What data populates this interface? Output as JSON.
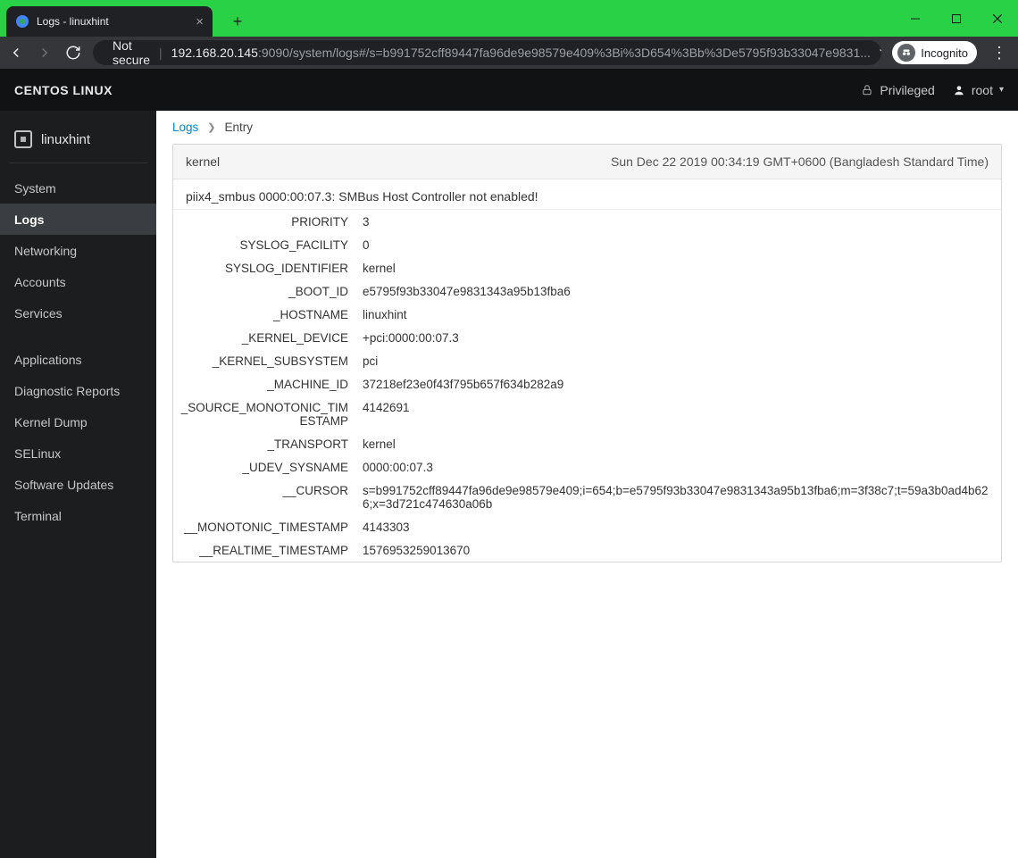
{
  "browser": {
    "tab_title": "Logs - linuxhint",
    "not_secure": "Not secure",
    "url_host": "192.168.20.145",
    "url_rest": ":9090/system/logs#/s=b991752cff89447fa96de9e98579e409%3Bi%3D654%3Bb%3De5795f93b33047e9831...",
    "incognito": "Incognito"
  },
  "app": {
    "brand": "CENTOS LINUX",
    "privileged": "Privileged",
    "user": "root"
  },
  "sidebar": {
    "host": "linuxhint",
    "groups": [
      {
        "items": [
          "System",
          "Logs",
          "Networking",
          "Accounts",
          "Services"
        ],
        "active_index": 1
      },
      {
        "items": [
          "Applications",
          "Diagnostic Reports",
          "Kernel Dump",
          "SELinux",
          "Software Updates",
          "Terminal"
        ],
        "active_index": -1
      }
    ]
  },
  "breadcrumb": {
    "root": "Logs",
    "current": "Entry"
  },
  "log_header": {
    "source": "kernel",
    "time": "Sun Dec 22 2019 00:34:19 GMT+0600 (Bangladesh Standard Time)"
  },
  "log_message": "piix4_smbus 0000:00:07.3: SMBus Host Controller not enabled!",
  "fields": [
    {
      "key": "PRIORITY",
      "value": "3"
    },
    {
      "key": "SYSLOG_FACILITY",
      "value": "0"
    },
    {
      "key": "SYSLOG_IDENTIFIER",
      "value": "kernel"
    },
    {
      "key": "_BOOT_ID",
      "value": "e5795f93b33047e9831343a95b13fba6"
    },
    {
      "key": "_HOSTNAME",
      "value": "linuxhint"
    },
    {
      "key": "_KERNEL_DEVICE",
      "value": "+pci:0000:00:07.3"
    },
    {
      "key": "_KERNEL_SUBSYSTEM",
      "value": "pci"
    },
    {
      "key": "_MACHINE_ID",
      "value": "37218ef23e0f43f795b657f634b282a9"
    },
    {
      "key": "_SOURCE_MONOTONIC_TIMESTAMP",
      "value": "4142691"
    },
    {
      "key": "_TRANSPORT",
      "value": "kernel"
    },
    {
      "key": "_UDEV_SYSNAME",
      "value": "0000:00:07.3"
    },
    {
      "key": "__CURSOR",
      "value": "s=b991752cff89447fa96de9e98579e409;i=654;b=e5795f93b33047e9831343a95b13fba6;m=3f38c7;t=59a3b0ad4b626;x=3d721c474630a06b"
    },
    {
      "key": "__MONOTONIC_TIMESTAMP",
      "value": "4143303"
    },
    {
      "key": "__REALTIME_TIMESTAMP",
      "value": "1576953259013670"
    }
  ]
}
